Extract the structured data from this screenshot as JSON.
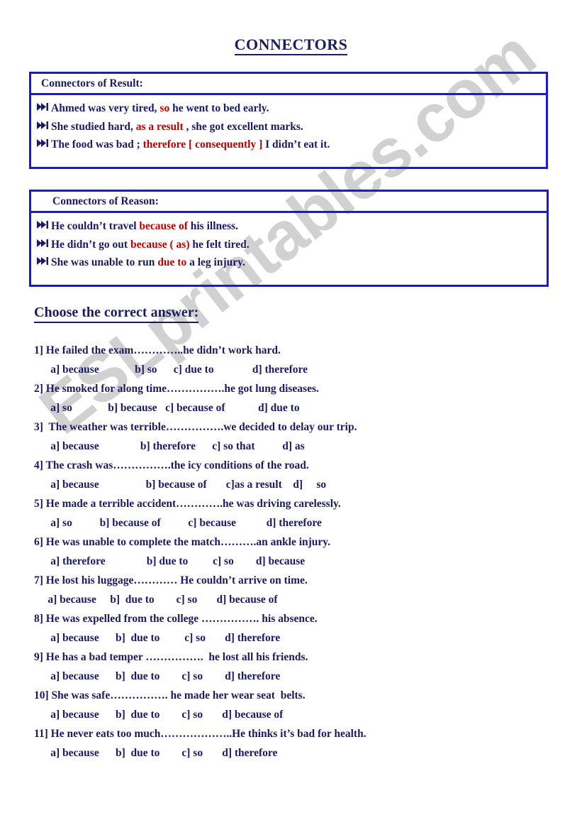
{
  "title": "CONNECTORS",
  "watermark": {
    "text": "ESLprintables.com"
  },
  "boxes": [
    {
      "heading": "Connectors of Result:",
      "lines": [
        {
          "before": "Ahmed was very tired, ",
          "highlight": "so",
          "after": " he went to bed early."
        },
        {
          "before": "She studied hard, ",
          "highlight": "as a result",
          "after": " , she got excellent marks."
        },
        {
          "before": "The food was bad ; ",
          "highlight": "therefore [ consequently ]",
          "after": " I didn’t eat it."
        }
      ]
    },
    {
      "heading": "Connectors of Reason:",
      "lines": [
        {
          "before": "He couldn’t travel ",
          "highlight": "because of",
          "after": " his illness."
        },
        {
          "before": "He didn’t go out ",
          "highlight": "because ( as)",
          "after": " he felt tired."
        },
        {
          "before": "She was unable to run ",
          "highlight": "due to",
          "after": " a leg injury."
        }
      ]
    }
  ],
  "exercise": {
    "heading": "Choose the correct answer:",
    "questions": [
      {
        "stem": "1] He failed the exam…………..he didn’t work hard.",
        "options": "      a] because             b] so      c] due to              d] therefore"
      },
      {
        "stem": "2] He smoked for along time…………….he got lung diseases.",
        "options": "      a] so             b] because   c] because of            d] due to"
      },
      {
        "stem": "3]  The weather was terrible…………….we decided to delay our trip.",
        "options": "      a] because               b] therefore      c] so that          d] as"
      },
      {
        "stem": "4] The crash was…………….the icy conditions of the road.",
        "options": "      a] because                 b] because of       c]as a result    d]     so"
      },
      {
        "stem": "5] He made a terrible accident………….he was driving carelessly.",
        "options": "      a] so          b] because of          c] because           d] therefore"
      },
      {
        "stem": "6] He was unable to complete the match……….an ankle injury.",
        "options": "      a] therefore               b] due to         c] so        d] because"
      },
      {
        "stem": "7] He lost his luggage………… He couldn’t arrive on time.",
        "options": "     a] because     b]  due to        c] so       d] because of"
      },
      {
        "stem": "8] He was expelled from the college ……………. his absence.",
        "options": "      a] because      b]  due to         c] so       d] therefore"
      },
      {
        "stem": "9] He has a bad temper …………….  he lost all his friends.",
        "options": "      a] because      b]  due to        c] so        d] therefore"
      },
      {
        "stem": "10] She was safe……………. he made her wear seat  belts.",
        "options": "      a] because      b]  due to        c] so       d] because of"
      },
      {
        "stem": "11] He never eats too much………………..He thinks it’s bad for health.",
        "options": "      a] because      b]  due to        c] so       d] therefore"
      }
    ]
  }
}
